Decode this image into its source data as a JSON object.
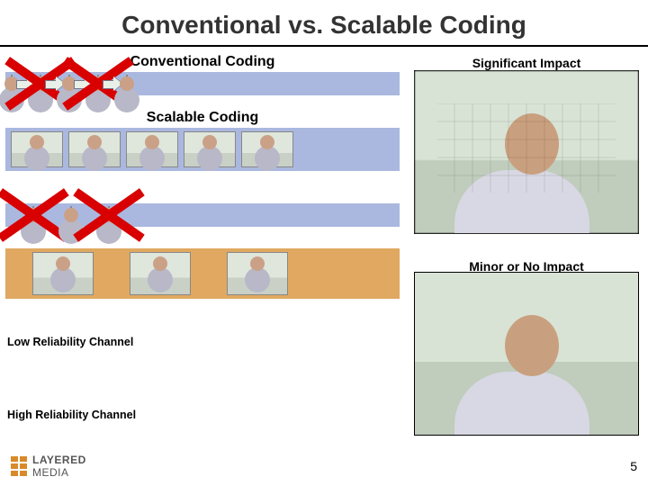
{
  "title": "Conventional vs. Scalable Coding",
  "labels": {
    "conventional": "Conventional Coding",
    "scalable": "Scalable Coding",
    "significant_impact": "Significant Impact",
    "minor_impact": "Minor or No Impact",
    "low_reliability": "Low Reliability Channel",
    "high_reliability": "High Reliability Channel"
  },
  "conventional_row": {
    "frame_count": 5,
    "lost_indices": [
      1,
      3
    ]
  },
  "scalable_rows": {
    "row1": {
      "frame_count": 5,
      "background": "blue"
    },
    "row2_low": {
      "frame_count": 3,
      "lost_indices": [
        0,
        2
      ],
      "background": "blue"
    },
    "row3_high": {
      "frame_count": 3,
      "lost_indices": [],
      "background": "orange"
    }
  },
  "footer": {
    "brand_top": "LAYERED",
    "brand_bottom": "MEDIA",
    "page": "5"
  }
}
